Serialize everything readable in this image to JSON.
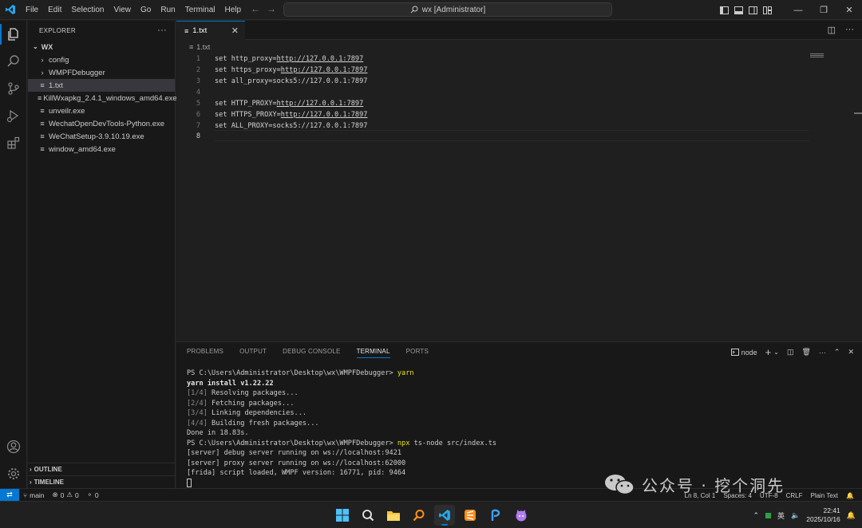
{
  "window": {
    "menu": [
      "File",
      "Edit",
      "Selection",
      "View",
      "Go",
      "Run",
      "Terminal",
      "Help"
    ],
    "search_text": "wx [Administrator]"
  },
  "sidebar": {
    "header": "EXPLORER",
    "folder": "WX",
    "items": [
      {
        "label": "config",
        "type": "folder"
      },
      {
        "label": "WMPFDebugger",
        "type": "folder"
      },
      {
        "label": "1.txt",
        "type": "file",
        "selected": true
      },
      {
        "label": "KillWxapkg_2.4.1_windows_amd64.exe",
        "type": "file"
      },
      {
        "label": "unveilr.exe",
        "type": "file"
      },
      {
        "label": "WechatOpenDevTools-Python.exe",
        "type": "file"
      },
      {
        "label": "WeChatSetup-3.9.10.19.exe",
        "type": "file"
      },
      {
        "label": "window_amd64.exe",
        "type": "file"
      }
    ],
    "outline": "OUTLINE",
    "timeline": "TIMELINE"
  },
  "editor": {
    "tab_label": "1.txt",
    "breadcrumb": "1.txt",
    "lines": [
      {
        "n": "1",
        "pre": "set http_proxy=",
        "link": "http://127.0.0.1:7897",
        "post": ""
      },
      {
        "n": "2",
        "pre": "set https_proxy=",
        "link": "http://127.0.0.1:7897",
        "post": ""
      },
      {
        "n": "3",
        "pre": "set all_proxy=socks5://127.0.0.1:7897",
        "link": "",
        "post": ""
      },
      {
        "n": "4",
        "pre": "",
        "link": "",
        "post": ""
      },
      {
        "n": "5",
        "pre": "set HTTP_PROXY=",
        "link": "http://127.0.0.1:7897",
        "post": ""
      },
      {
        "n": "6",
        "pre": "set HTTPS_PROXY=",
        "link": "http://127.0.0.1:7897",
        "post": ""
      },
      {
        "n": "7",
        "pre": "set ALL_PROXY=socks5://127.0.0.1:7897",
        "link": "",
        "post": ""
      },
      {
        "n": "8",
        "pre": "",
        "link": "",
        "post": ""
      }
    ]
  },
  "panel": {
    "tabs": [
      "PROBLEMS",
      "OUTPUT",
      "DEBUG CONSOLE",
      "TERMINAL",
      "PORTS"
    ],
    "active_tab": "TERMINAL",
    "terminal_name": "node",
    "terminal_lines": [
      {
        "a": "PS C:\\Users\\Administrator\\Desktop\\wx\\WMPFDebugger> ",
        "b": "yarn",
        "c": ""
      },
      {
        "a": "yarn install v1.22.22",
        "b": "",
        "c": ""
      },
      {
        "a": "[1/4]",
        "b": "",
        "c": " Resolving packages..."
      },
      {
        "a": "[2/4]",
        "b": "",
        "c": " Fetching packages..."
      },
      {
        "a": "[3/4]",
        "b": "",
        "c": " Linking dependencies..."
      },
      {
        "a": "[4/4]",
        "b": "",
        "c": " Building fresh packages..."
      },
      {
        "a": "Done in 18.83s.",
        "b": "",
        "c": ""
      },
      {
        "a": "PS C:\\Users\\Administrator\\Desktop\\wx\\WMPFDebugger> ",
        "b": "npx",
        "c": " ts-node src/index.ts"
      },
      {
        "a": "[server] debug server running on ws://localhost:9421",
        "b": "",
        "c": ""
      },
      {
        "a": "[server] proxy server running on ws://localhost:62000",
        "b": "",
        "c": ""
      },
      {
        "a": "[frida] script loaded, WMPF version: 16771, pid: 9464",
        "b": "",
        "c": ""
      }
    ]
  },
  "statusbar": {
    "branch": "main",
    "errors": "0",
    "warnings": "0",
    "ports": "0",
    "position": "Ln 8, Col 1",
    "spaces": "Spaces: 4",
    "encoding": "UTF-8",
    "eol": "CRLF",
    "language": "Plain Text"
  },
  "taskbar": {
    "ime": "英",
    "time": "22:41",
    "date": "2025/10/16"
  },
  "watermark": {
    "text": "公众号 · 挖个洞先"
  }
}
